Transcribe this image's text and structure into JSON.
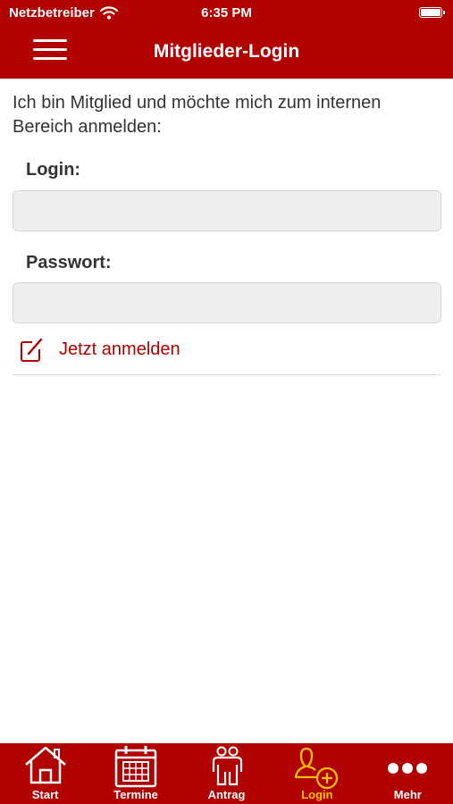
{
  "status_bar": {
    "carrier": "Netzbetreiber",
    "time": "6:35 PM",
    "wifi_icon": "wifi-icon",
    "battery_icon": "battery-icon"
  },
  "header": {
    "title": "Mitglieder-Login",
    "menu_icon": "hamburger-menu-icon",
    "background": "#b00000"
  },
  "form": {
    "intro": "Ich bin Mitglied und möchte mich zum internen Bereich anmelden:",
    "login_label": "Login:",
    "login_value": "",
    "password_label": "Passwort:",
    "password_value": "",
    "submit_label": "Jetzt anmelden",
    "submit_icon": "edit-icon",
    "accent": "#b00000"
  },
  "tabbar": {
    "active_color": "#f7c200",
    "items": [
      {
        "label": "Start",
        "icon": "home-icon"
      },
      {
        "label": "Termine",
        "icon": "calendar-icon"
      },
      {
        "label": "Antrag",
        "icon": "people-icon"
      },
      {
        "label": "Login",
        "icon": "user-add-icon",
        "active": true
      },
      {
        "label": "Mehr",
        "icon": "more-dots-icon"
      }
    ]
  }
}
